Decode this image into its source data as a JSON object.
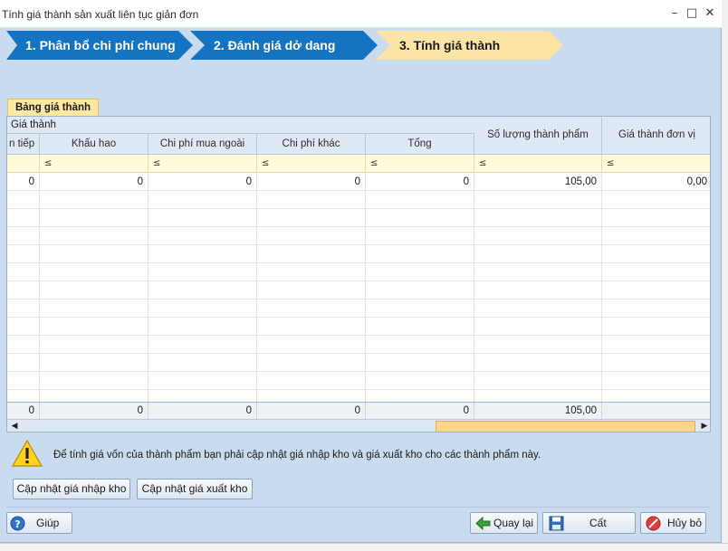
{
  "window": {
    "title": "Tính giá thành sản xuất liên tục giản đơn",
    "minimize": "–",
    "maximize": "□",
    "close": "✕"
  },
  "steps": [
    {
      "label": "1. Phân bổ chi phí chung",
      "state": "done",
      "color": "#1574c2"
    },
    {
      "label": "2. Đánh giá dở dang",
      "state": "done",
      "color": "#1574c2"
    },
    {
      "label": "3. Tính giá thành",
      "state": "active",
      "color": "#fbe4a6"
    }
  ],
  "tab": {
    "label": "Bảng giá thành"
  },
  "grid": {
    "group_header": "Giá thành",
    "columns": [
      "n tiếp",
      "Khấu hao",
      "Chi phí mua ngoài",
      "Chi phí khác",
      "Tổng",
      "Số lượng thành phẩm",
      "Giá thành đơn vị"
    ],
    "filter_symbol": "≤",
    "rows": [
      [
        "0",
        "0",
        "0",
        "0",
        "0",
        "105,00",
        "0,00"
      ],
      [
        "",
        "",
        "",
        "",
        "",
        "",
        ""
      ],
      [
        "",
        "",
        "",
        "",
        "",
        "",
        ""
      ],
      [
        "",
        "",
        "",
        "",
        "",
        "",
        ""
      ],
      [
        "",
        "",
        "",
        "",
        "",
        "",
        ""
      ],
      [
        "",
        "",
        "",
        "",
        "",
        "",
        ""
      ],
      [
        "",
        "",
        "",
        "",
        "",
        "",
        ""
      ],
      [
        "",
        "",
        "",
        "",
        "",
        "",
        ""
      ],
      [
        "",
        "",
        "",
        "",
        "",
        "",
        ""
      ],
      [
        "",
        "",
        "",
        "",
        "",
        "",
        ""
      ],
      [
        "",
        "",
        "",
        "",
        "",
        "",
        ""
      ],
      [
        "",
        "",
        "",
        "",
        "",
        "",
        ""
      ],
      [
        "",
        "",
        "",
        "",
        "",
        "",
        ""
      ]
    ],
    "totals": [
      "0",
      "0",
      "0",
      "0",
      "0",
      "105,00",
      ""
    ]
  },
  "notice": {
    "icon": "warning-icon",
    "text": "Để tính giá vốn của thành phẩm bạn phải cập nhật giá nhập kho và giá xuất kho cho các thành phẩm này."
  },
  "actions": {
    "update_import_price": "Cập nhật giá nhập kho",
    "update_export_price": "Cập nhật giá xuất kho"
  },
  "footer": {
    "help": "Giúp",
    "back": "Quay lại",
    "save": "Cất",
    "cancel": "Hủy bỏ"
  }
}
